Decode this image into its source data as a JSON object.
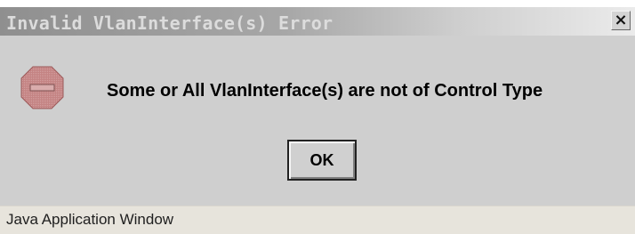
{
  "window": {
    "title": "Invalid VlanInterface(s) Error",
    "close_label": "×"
  },
  "dialog": {
    "icon": "stop-icon",
    "message": "Some or All VlanInterface(s) are not of Control Type",
    "ok_label": "OK"
  },
  "status_bar": {
    "text": "Java Application Window"
  },
  "colors": {
    "dialog_background": "#cfcfcf",
    "title_text": "#dcdcdc",
    "stop_icon": "#c68a8a",
    "status_background": "#e7e4dc"
  }
}
